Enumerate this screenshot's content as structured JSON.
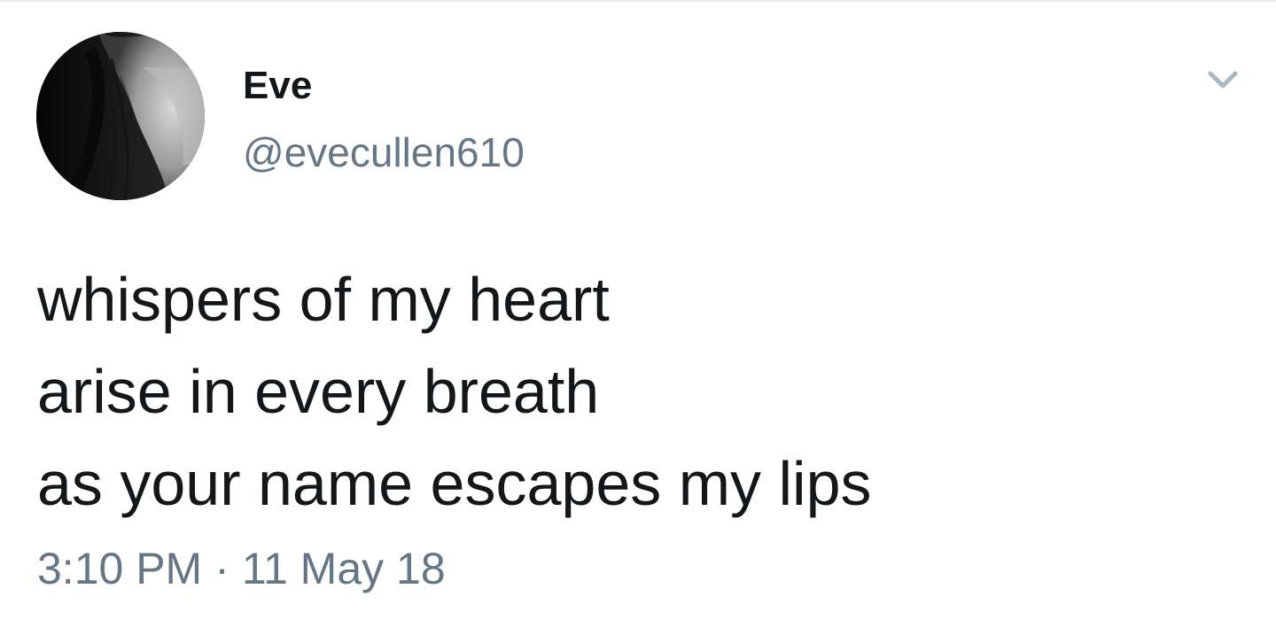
{
  "author": {
    "display_name": "Eve",
    "handle": "@evecullen610",
    "avatar": "avatar-photo"
  },
  "tweet": {
    "lines": [
      "whispers of my heart",
      "arise in every breath",
      "as your name escapes my lips"
    ],
    "time": "3:10 PM",
    "separator": "·",
    "date": "11 May 18"
  },
  "icons": {
    "menu": "chevron-down-icon"
  },
  "colors": {
    "text_primary": "#14171a",
    "text_secondary": "#657786",
    "divider": "#e6ecf0",
    "caret": "#aab8c2"
  }
}
